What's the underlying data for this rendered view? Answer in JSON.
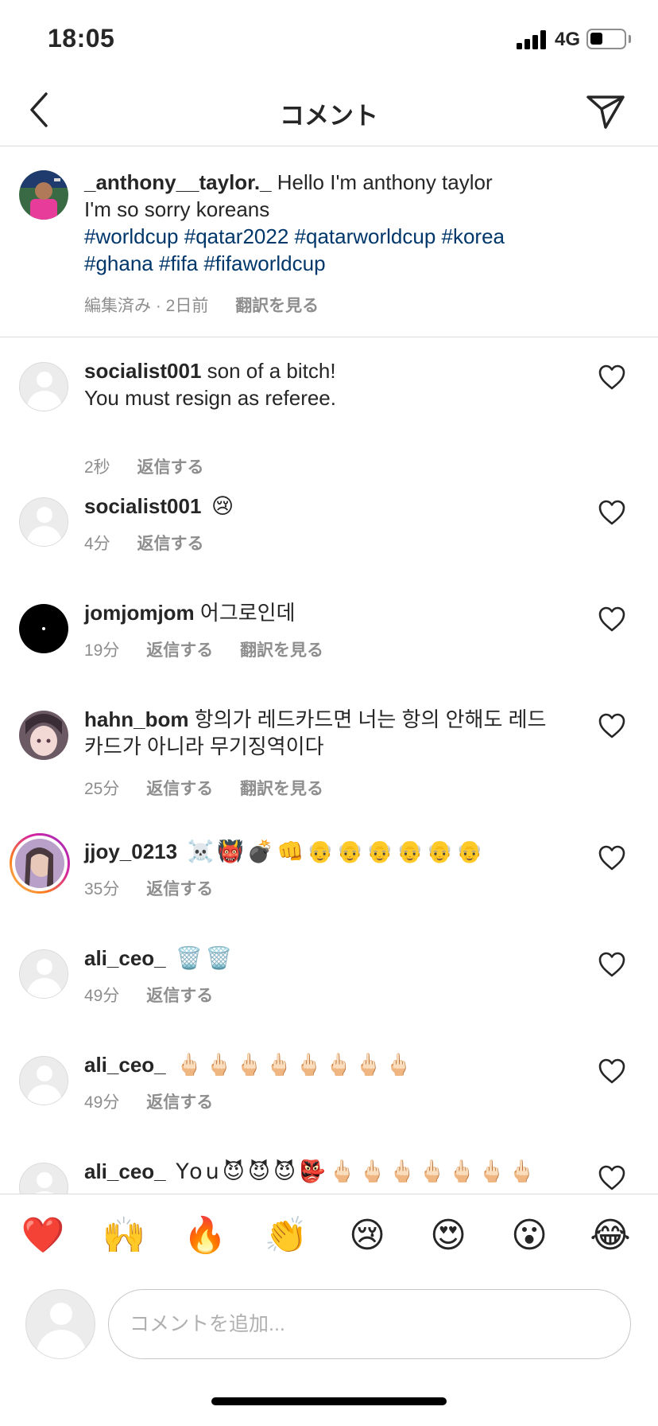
{
  "status_bar": {
    "time": "18:05",
    "network": "4G"
  },
  "nav": {
    "title": "コメント"
  },
  "caption": {
    "username": "_anthony__taylor._",
    "text": " Hello I'm anthony taylor",
    "line2": "I'm so sorry koreans",
    "hashtags_line1": "#worldcup #qatar2022 #qatarworldcup #korea",
    "hashtags_line2": "#ghana #fifa #fifaworldcup",
    "edited": "編集済み · 2日前",
    "translate": "翻訳を見る"
  },
  "comments": [
    {
      "username": "socialist001",
      "text": " son of a bitch!",
      "text2": "You must resign as referee.",
      "time": "2秒",
      "reply": "返信する"
    },
    {
      "username": "socialist001",
      "text": " 😢",
      "time": "4分",
      "reply": "返信する"
    },
    {
      "username": "jomjomjom",
      "text": " 어그로인데",
      "time": "19分",
      "reply": "返信する",
      "translate": "翻訳を見る"
    },
    {
      "username": "hahn_bom",
      "text": " 항의가 레드카드면 너는 항의 안해도 레드",
      "text2": "카드가 아니라 무기징역이다",
      "time": "25分",
      "reply": "返信する",
      "translate": "翻訳を見る"
    },
    {
      "username": "jjoy_0213",
      "text": " ☠️👹💣👊👴👴👴👴👴👴",
      "time": "35分",
      "reply": "返信する"
    },
    {
      "username": "ali_ceo_",
      "text": " 🗑️🗑️",
      "time": "49分",
      "reply": "返信する"
    },
    {
      "username": "ali_ceo_",
      "text": " 🖕🏻🖕🏻🖕🏻🖕🏻🖕🏻🖕🏻🖕🏻🖕🏻",
      "time": "49分",
      "reply": "返信する"
    },
    {
      "username": "ali_ceo_",
      "text": " You😈😈😈👺🖕🏻🖕🏻🖕🏻🖕🏻🖕🏻🖕🏻🖕🏻"
    }
  ],
  "reactions": [
    "❤️",
    "🙌",
    "🔥",
    "👏",
    "😢",
    "😍",
    "😮",
    "😂"
  ],
  "composer": {
    "placeholder": "コメントを追加..."
  },
  "colors": {
    "hashtag": "#00376b",
    "secondary_text": "#8e8e8e",
    "divider": "#dbdbdb",
    "story_ring": "#d6249f"
  }
}
